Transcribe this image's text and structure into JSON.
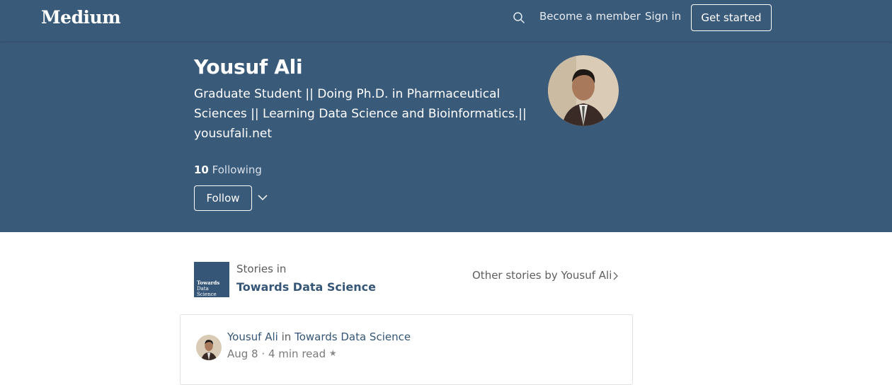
{
  "nav": {
    "logo": "Medium",
    "search_icon": "search-icon",
    "become_member": "Become a member",
    "sign_in": "Sign in",
    "get_started": "Get started"
  },
  "profile": {
    "name": "Yousuf Ali",
    "bio": "Graduate Student || Doing Ph.D. in Pharmaceutical Sciences || Learning Data Science and Bioinformatics.|| yousufali.net",
    "following_count": "10",
    "following_label": "Following",
    "follow_button": "Follow",
    "more_icon": "chevron-down-icon"
  },
  "publication": {
    "logo_line1": "Towards",
    "logo_line2": "Data Science",
    "stories_in": "Stories in",
    "name": "Towards Data Science",
    "other_stories": "Other stories by Yousuf Ali"
  },
  "story_card": {
    "author": "Yousuf Ali",
    "in_word": "in",
    "publication": "Towards Data Science",
    "date": "Aug 8",
    "separator": "·",
    "read_time": "4 min read",
    "star": "★"
  },
  "colors": {
    "header_bg": "#3a5a7a",
    "accent": "#355676"
  }
}
